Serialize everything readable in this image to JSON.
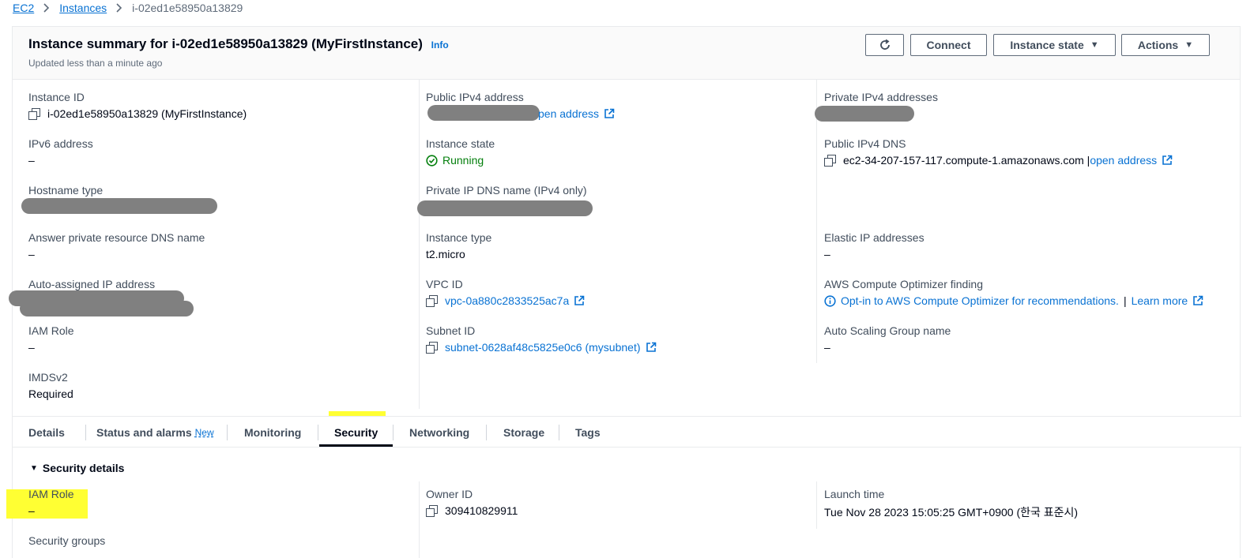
{
  "breadcrumb": {
    "root": "EC2",
    "section": "Instances",
    "current": "i-02ed1e58950a13829"
  },
  "header": {
    "title": "Instance summary for i-02ed1e58950a13829 (MyFirstInstance)",
    "info": "Info",
    "updated": "Updated less than a minute ago",
    "buttons": {
      "connect": "Connect",
      "instance_state": "Instance state",
      "actions": "Actions"
    }
  },
  "details": {
    "instance_id": {
      "label": "Instance ID",
      "value": "i-02ed1e58950a13829 (MyFirstInstance)"
    },
    "ipv6": {
      "label": "IPv6 address",
      "value": "–"
    },
    "hostname_type": {
      "label": "Hostname type"
    },
    "answer_dns": {
      "label": "Answer private resource DNS name",
      "value": "–"
    },
    "auto_ip": {
      "label": "Auto-assigned IP address"
    },
    "iam_role": {
      "label": "IAM Role",
      "value": "–"
    },
    "imdsv2": {
      "label": "IMDSv2",
      "value": "Required"
    },
    "public_ipv4": {
      "label": "Public IPv4 address",
      "link": "pen address"
    },
    "instance_state": {
      "label": "Instance state",
      "value": "Running"
    },
    "private_ip_dns": {
      "label": "Private IP DNS name (IPv4 only)"
    },
    "instance_type": {
      "label": "Instance type",
      "value": "t2.micro"
    },
    "vpc_id": {
      "label": "VPC ID",
      "value": "vpc-0a880c2833525ac7a"
    },
    "subnet_id": {
      "label": "Subnet ID",
      "value": "subnet-0628af48c5825e0c6 (mysubnet)"
    },
    "private_ipv4": {
      "label": "Private IPv4 addresses"
    },
    "public_dns": {
      "label": "Public IPv4 DNS",
      "value": "ec2-34-207-157-117.compute-1.amazonaws.com |",
      "link": "open address"
    },
    "elastic_ip": {
      "label": "Elastic IP addresses",
      "value": "–"
    },
    "optimizer": {
      "label": "AWS Compute Optimizer finding",
      "link": "Opt-in to AWS Compute Optimizer for recommendations.",
      "sep": "|",
      "learn": "Learn more"
    },
    "asg": {
      "label": "Auto Scaling Group name",
      "value": "–"
    }
  },
  "tabs": [
    {
      "label": "Details"
    },
    {
      "label": "Status and alarms",
      "badge": "New"
    },
    {
      "label": "Monitoring"
    },
    {
      "label": "Security"
    },
    {
      "label": "Networking"
    },
    {
      "label": "Storage"
    },
    {
      "label": "Tags"
    }
  ],
  "security": {
    "title": "Security details",
    "iam_role": {
      "label": "IAM Role",
      "value": "–"
    },
    "owner_id": {
      "label": "Owner ID",
      "value": "309410829911"
    },
    "launch_time": {
      "label": "Launch time",
      "value": "Tue Nov 28 2023 15:05:25 GMT+0900 (한국 표준시)"
    },
    "security_groups": {
      "label": "Security groups"
    }
  },
  "colors": {
    "link": "#0972d3",
    "running": "#037f0c",
    "highlight": "#ffff33",
    "redaction": "#808080"
  }
}
